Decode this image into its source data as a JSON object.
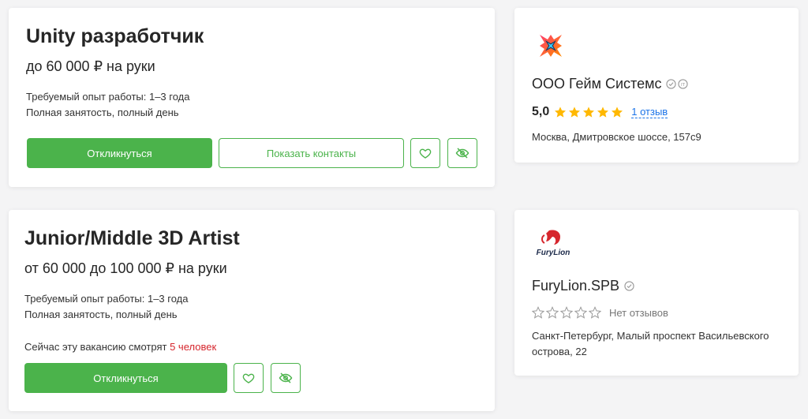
{
  "vacancies": [
    {
      "title": "Unity разработчик",
      "salary": "до 60 000 ₽ на руки",
      "experience": "Требуемый опыт работы: 1–3 года",
      "employment": "Полная занятость, полный день",
      "apply_label": "Откликнуться",
      "contacts_label": "Показать контакты"
    },
    {
      "title": "Junior/Middle 3D Artist",
      "salary": "от 60 000 до 100 000 ₽ на руки",
      "experience": "Требуемый опыт работы: 1–3 года",
      "employment": "Полная занятость, полный день",
      "watching_prefix": "Сейчас эту вакансию смотрят ",
      "watching_count": "5 человек",
      "apply_label": "Откликнуться"
    }
  ],
  "companies": [
    {
      "name": "ООО Гейм Системс",
      "rating": "5,0",
      "stars_filled": 5,
      "reviews": "1 отзыв",
      "address": "Москва, Дмитровское шоссе, 157с9",
      "logo_text": ""
    },
    {
      "name": "FuryLion.SPB",
      "stars_filled": 0,
      "reviews": "Нет отзывов",
      "address": "Санкт-Петербург, Малый проспект Васильевского острова, 22",
      "logo_text": "FuryLion"
    }
  ],
  "colors": {
    "accent": "#4bb34b",
    "star": "#ffb800",
    "link": "#1a73e8",
    "highlight": "#d6262d"
  },
  "icons": [
    "heart-icon",
    "eye-off-icon",
    "verified-icon",
    "it-accreditation-icon",
    "star-icon"
  ]
}
